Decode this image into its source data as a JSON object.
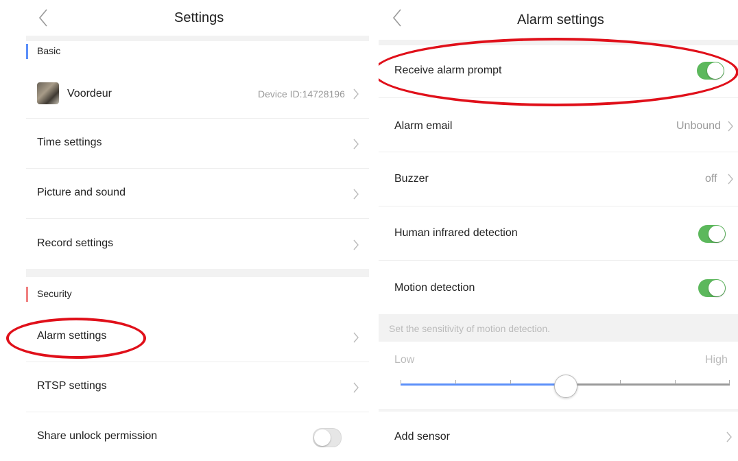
{
  "left": {
    "title": "Settings",
    "sections": {
      "basic": "Basic",
      "security": "Security"
    },
    "device": {
      "name": "Voordeur",
      "id": "Device ID:14728196"
    },
    "rows": {
      "time": "Time settings",
      "picture": "Picture and sound",
      "record": "Record settings",
      "alarm": "Alarm settings",
      "rtsp": "RTSP settings",
      "share": "Share unlock permission"
    },
    "share_toggle_on": false,
    "colors": {
      "basic_mark": "#5b8ff9",
      "security_mark": "#f08080"
    }
  },
  "right": {
    "title": "Alarm settings",
    "rows": {
      "receive": "Receive alarm prompt",
      "email": "Alarm email",
      "email_value": "Unbound",
      "buzzer": "Buzzer",
      "buzzer_value": "off",
      "infrared": "Human infrared detection",
      "motion": "Motion detection",
      "add_sensor": "Add sensor"
    },
    "toggles": {
      "receive": true,
      "infrared": true,
      "motion": true
    },
    "sensitivity": {
      "caption": "Set the sensitivity of motion detection.",
      "low": "Low",
      "high": "High",
      "level_fraction": 0.5
    },
    "colors": {
      "toggle_on": "#5cb85c",
      "slider_active": "#5b8ff9"
    }
  },
  "annotation_color": "#e0101a",
  "icons": [
    "back-chevron-icon",
    "chevron-right-icon"
  ]
}
